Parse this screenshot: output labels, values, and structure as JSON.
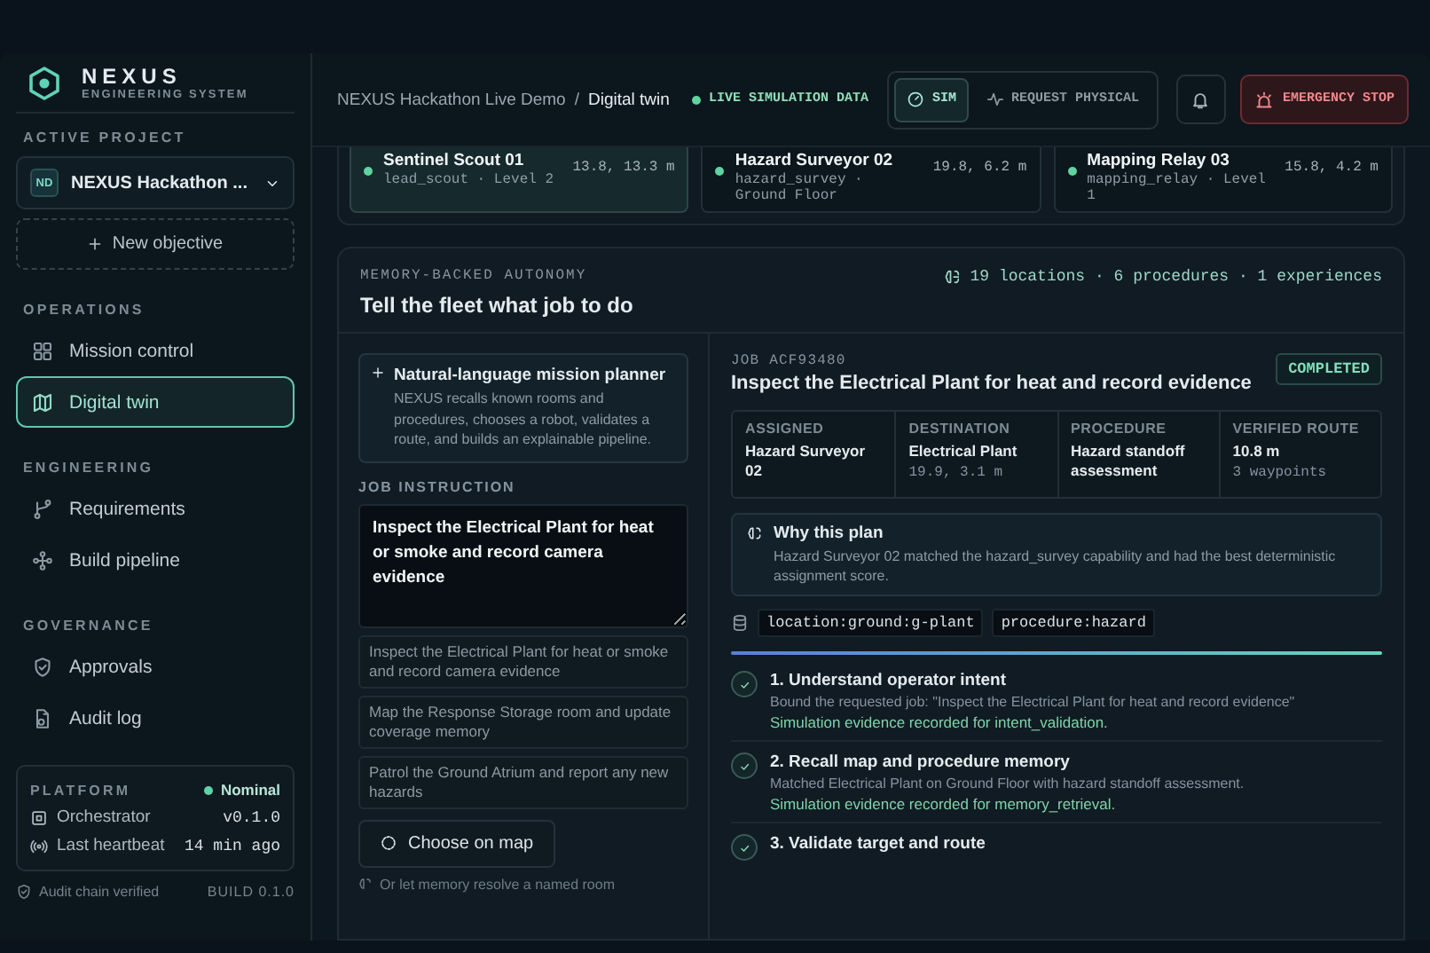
{
  "brand": {
    "name": "NEXUS",
    "subtitle": "ENGINEERING SYSTEM"
  },
  "sidebar": {
    "project_label": "ACTIVE PROJECT",
    "project": {
      "initials": "ND",
      "name": "NEXUS Hackathon ..."
    },
    "new_objective": "New objective",
    "sections": [
      {
        "title": "OPERATIONS",
        "items": [
          {
            "label": "Mission control",
            "selected": false
          },
          {
            "label": "Digital twin",
            "selected": true
          }
        ]
      },
      {
        "title": "ENGINEERING",
        "items": [
          {
            "label": "Requirements",
            "selected": false
          },
          {
            "label": "Build pipeline",
            "selected": false
          }
        ]
      },
      {
        "title": "GOVERNANCE",
        "items": [
          {
            "label": "Approvals",
            "selected": false
          },
          {
            "label": "Audit log",
            "selected": false
          }
        ]
      }
    ],
    "platform": {
      "title": "PLATFORM",
      "status": "Nominal",
      "rows": [
        {
          "label": "Orchestrator",
          "value": "v0.1.0"
        },
        {
          "label": "Last heartbeat",
          "value": "14 min ago"
        }
      ]
    },
    "footer": {
      "audit": "Audit chain verified",
      "build": "BUILD 0.1.0"
    }
  },
  "topbar": {
    "breadcrumb": [
      "NEXUS Hackathon Live Demo",
      "Digital twin"
    ],
    "separator": "/",
    "live": "LIVE SIMULATION DATA",
    "modes": [
      {
        "label": "SIM",
        "selected": true
      },
      {
        "label": "REQUEST PHYSICAL",
        "selected": false
      }
    ],
    "emergency": "EMERGENCY STOP"
  },
  "robots": [
    {
      "name": "Sentinel Scout 01",
      "details": "lead_scout · Level 2",
      "position": "13.8, 13.3 m",
      "selected": true
    },
    {
      "name": "Hazard Surveyor 02",
      "details": "hazard_survey · Ground Floor",
      "position": "19.8, 6.2 m",
      "selected": false
    },
    {
      "name": "Mapping Relay 03",
      "details": "mapping_relay · Level 1",
      "position": "15.8, 4.2 m",
      "selected": false
    }
  ],
  "planner": {
    "eyebrow": "MEMORY-BACKED AUTONOMY",
    "title": "Tell the fleet what job to do",
    "stats": "19 locations · 6 procedures · 1 experiences",
    "intro": {
      "title": "Natural-language mission planner",
      "text": "NEXUS recalls known rooms and procedures, chooses a robot, validates a route, and builds an explainable pipeline."
    },
    "instruction_label": "JOB INSTRUCTION",
    "instruction": "Inspect the Electrical Plant for heat or smoke and record camera evidence",
    "suggestions": [
      "Inspect the Electrical Plant for heat or smoke and record camera evidence",
      "Map the Response Storage room and update coverage memory",
      "Patrol the Ground Atrium and report any new hazards"
    ],
    "map_button": "Choose on map",
    "hint": "Or let memory resolve a named room"
  },
  "job": {
    "id": "JOB ACF93480",
    "status": "COMPLETED",
    "title": "Inspect the Electrical Plant for heat and record evidence",
    "facts": [
      {
        "label": "ASSIGNED",
        "value": "Hazard Surveyor 02"
      },
      {
        "label": "DESTINATION",
        "value": "Electrical Plant",
        "detail": "19.9, 3.1 m"
      },
      {
        "label": "PROCEDURE",
        "value": "Hazard standoff assessment"
      },
      {
        "label": "VERIFIED ROUTE",
        "value": "10.8 m",
        "detail": "3 waypoints"
      }
    ],
    "why": {
      "title": "Why this plan",
      "text": "Hazard Surveyor 02 matched the hazard_survey capability and had the best deterministic assignment score."
    },
    "tags": [
      "location:ground:g-plant",
      "procedure:hazard"
    ],
    "progress": {
      "level": 1
    },
    "steps": [
      {
        "title": "1. Understand operator intent",
        "text": "Bound the requested job: \"Inspect the Electrical Plant for heat and record evidence\"",
        "evidence": "Simulation evidence recorded for intent_validation.",
        "done": true
      },
      {
        "title": "2. Recall map and procedure memory",
        "text": "Matched Electrical Plant on Ground Floor with hazard standoff assessment.",
        "evidence": "Simulation evidence recorded for memory_retrieval.",
        "done": true
      },
      {
        "title": "3. Validate target and route",
        "done": true
      }
    ]
  }
}
